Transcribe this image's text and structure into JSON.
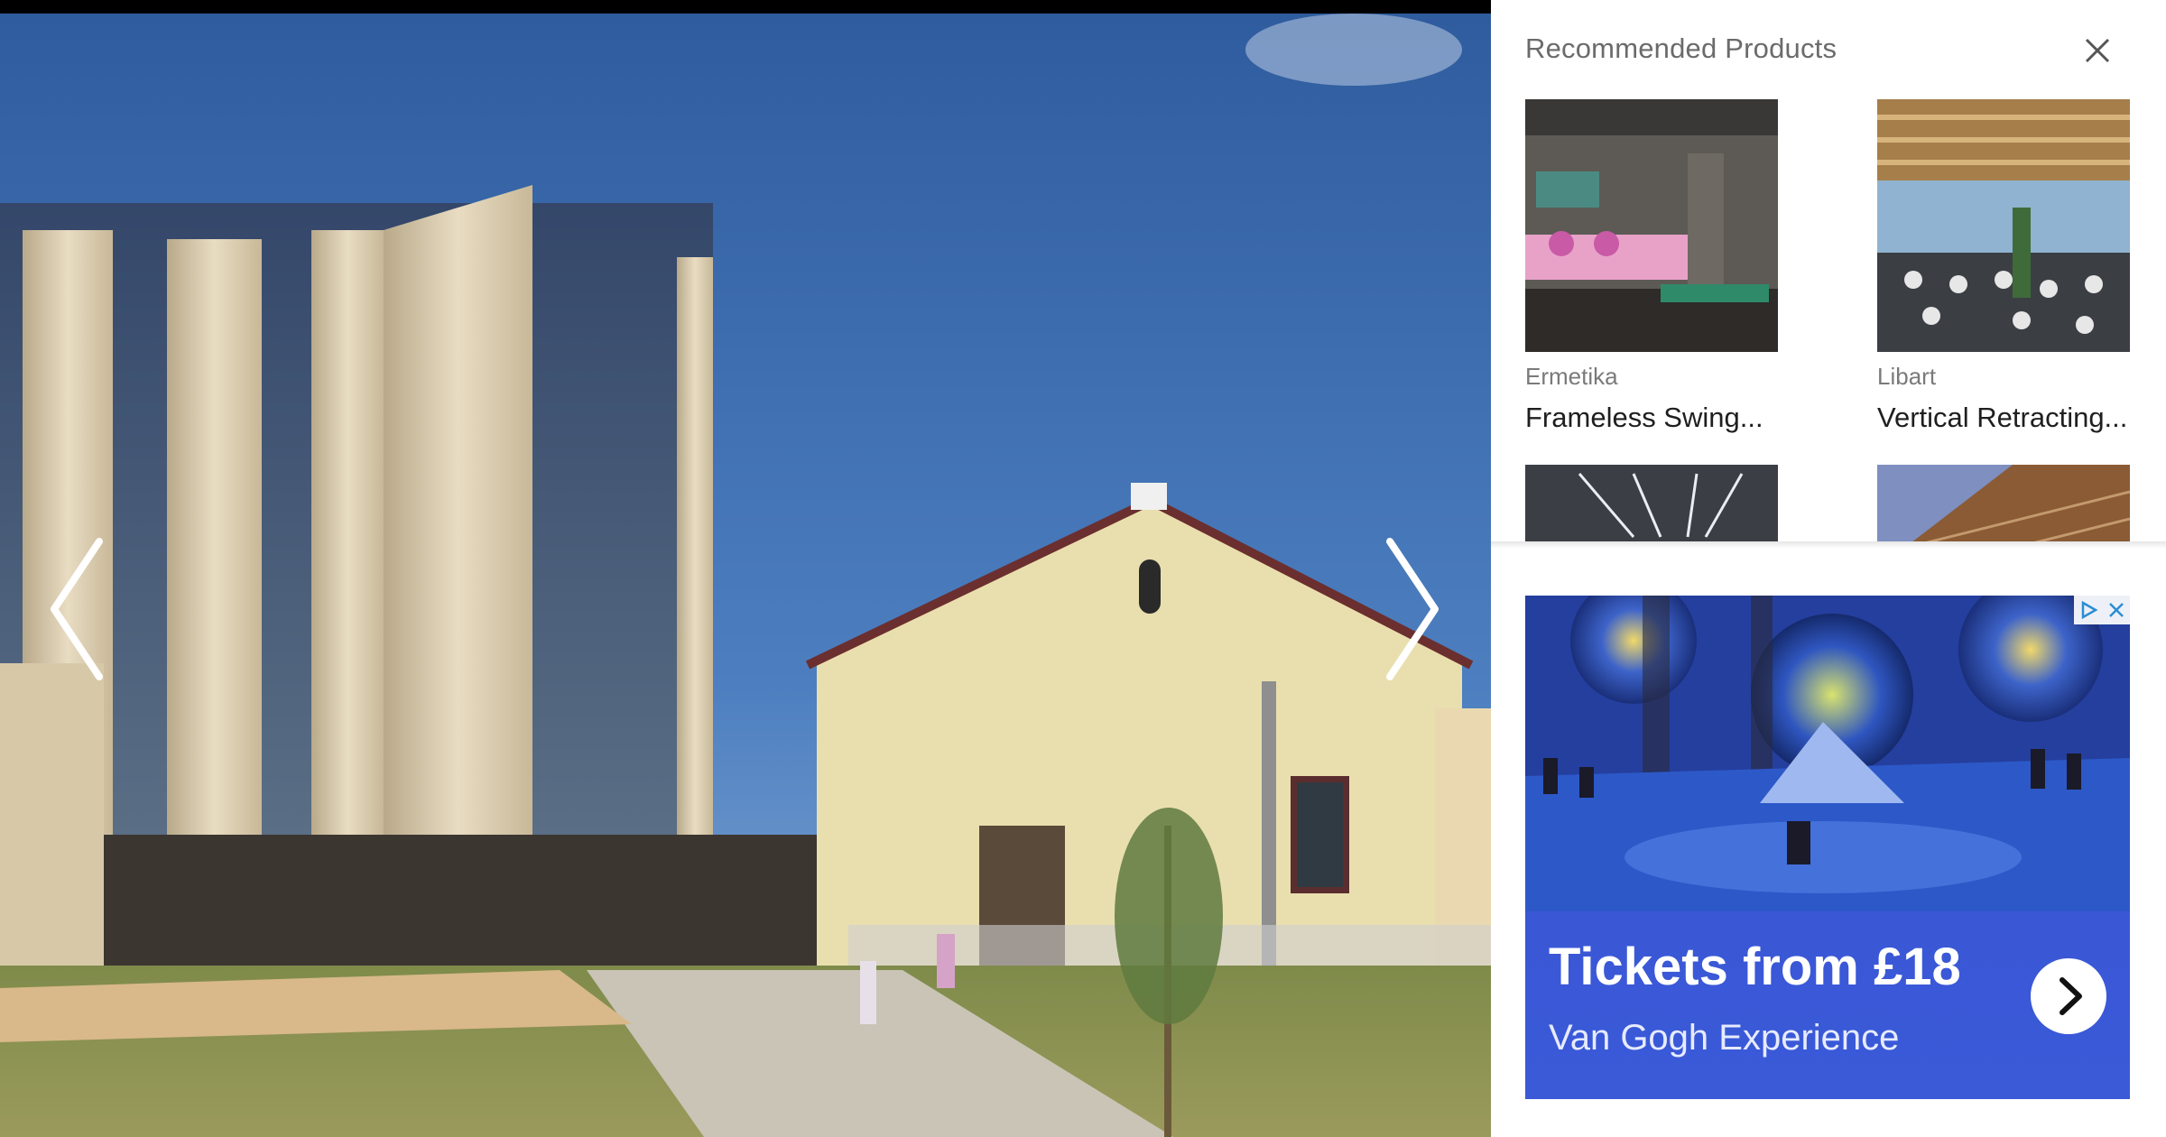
{
  "gallery": {
    "prev_label": "Previous image",
    "next_label": "Next image",
    "icons": {
      "prev": "chevron-left-icon",
      "next": "chevron-right-icon"
    }
  },
  "sidebar": {
    "title": "Recommended Products",
    "close_icon": "close-icon",
    "products": [
      {
        "brand": "Ermetika",
        "name": "Frameless Swing..."
      },
      {
        "brand": "Libart",
        "name": "Vertical Retracting..."
      },
      {
        "brand": "",
        "name": ""
      },
      {
        "brand": "",
        "name": ""
      }
    ]
  },
  "ad": {
    "headline": "Tickets from £18",
    "subline": "Van Gogh Experience",
    "go_icon": "chevron-right-icon",
    "choices_icons": [
      "adchoices-icon",
      "close-icon"
    ],
    "colors": {
      "band": "#3a57d6"
    }
  },
  "colors": {
    "gallery_bg": "#000000",
    "sky": "#3f6fb0",
    "title_text": "#6b6b6b"
  }
}
